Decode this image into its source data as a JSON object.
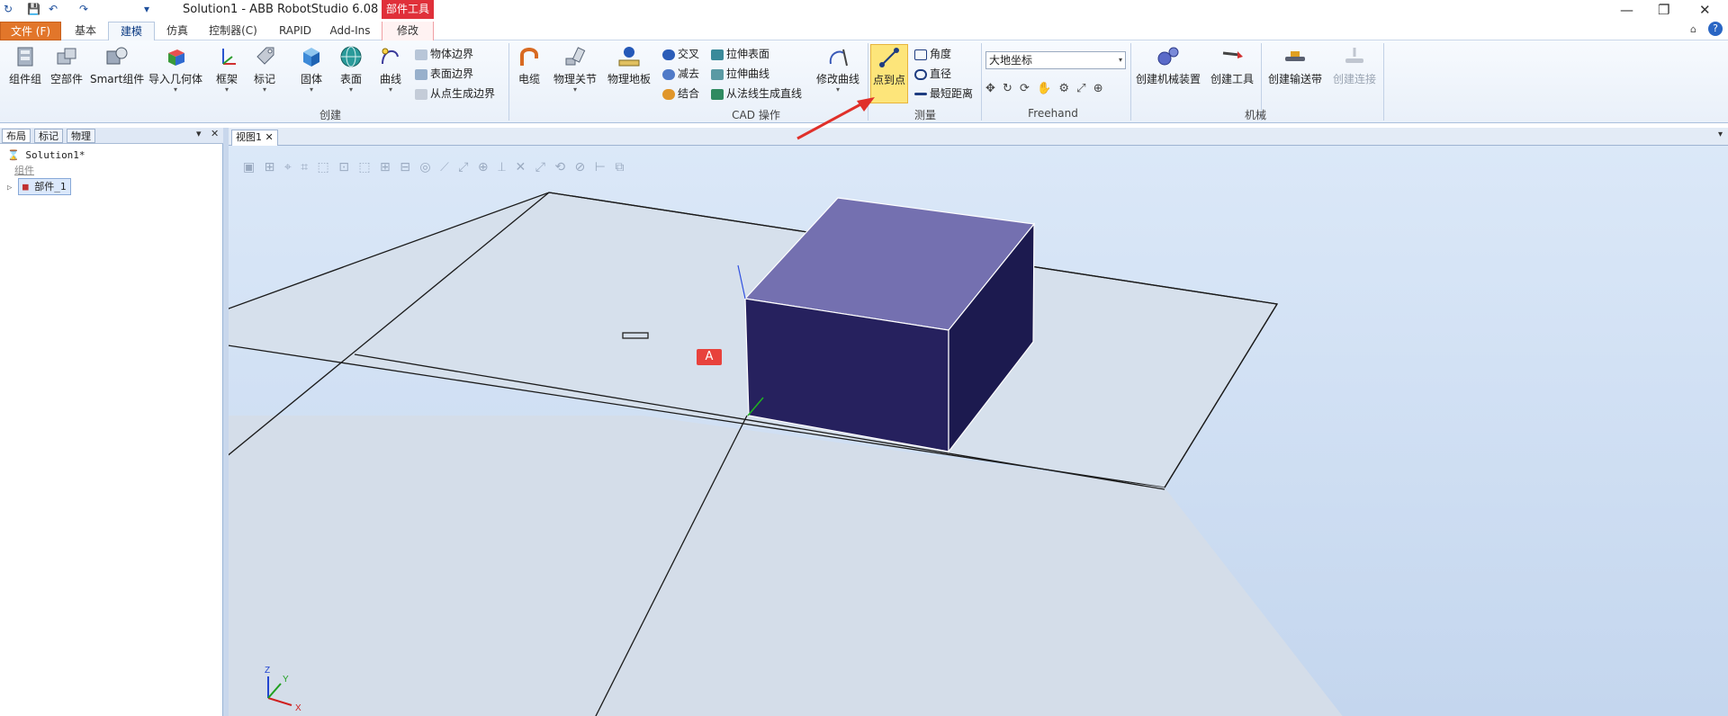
{
  "window": {
    "title": "Solution1 - ABB RobotStudio 6.08",
    "context_tool": "部件工具",
    "controls": [
      "—",
      "❐",
      "✕"
    ]
  },
  "quick_access": [
    "↻",
    "💾",
    "↶",
    "↷",
    "▾"
  ],
  "tabs": [
    {
      "label": "文件 (F)"
    },
    {
      "label": "基本"
    },
    {
      "label": "建模"
    },
    {
      "label": "仿真"
    },
    {
      "label": "控制器(C)"
    },
    {
      "label": "RAPID"
    },
    {
      "label": "Add-Ins"
    },
    {
      "label": "修改"
    }
  ],
  "ribbon": {
    "create": {
      "group_label": "创建",
      "buttons": [
        "组件组",
        "空部件",
        "Smart组件",
        "导入几何体",
        "框架",
        "标记",
        "固体",
        "表面",
        "曲线"
      ],
      "small": [
        "物体边界",
        "表面边界",
        "从点生成边界"
      ]
    },
    "cad": {
      "group_label": "CAD 操作",
      "buttons": [
        "电缆",
        "物理关节",
        "物理地板"
      ],
      "small": [
        "交叉",
        "减去",
        "结合",
        "拉伸表面",
        "拉伸曲线",
        "从法线生成直线"
      ],
      "modify_curve": "修改曲线"
    },
    "measure": {
      "group_label": "测量",
      "point_to_point": "点到点",
      "small": [
        "角度",
        "直径",
        "最短距离"
      ]
    },
    "freehand": {
      "group_label": "Freehand",
      "coord_select": "大地坐标"
    },
    "mechanism": {
      "group_label": "机械",
      "buttons": [
        "创建机械装置",
        "创建工具",
        "创建输送带",
        "创建连接"
      ]
    }
  },
  "left_panel": {
    "tabs": [
      "布局",
      "标记",
      "物理"
    ],
    "tree": {
      "solution": "Solution1*",
      "group_label": "组件",
      "part": "部件_1"
    }
  },
  "view": {
    "tab_label": "视图1",
    "marker_label": "A",
    "axes": {
      "x": "X",
      "y": "Y",
      "z": "Z"
    }
  },
  "colors": {
    "accent": "#e2762a",
    "context": "#e0303a",
    "box_top": "#7470b0",
    "box_front": "#26215e",
    "box_side": "#1c1a4f"
  }
}
